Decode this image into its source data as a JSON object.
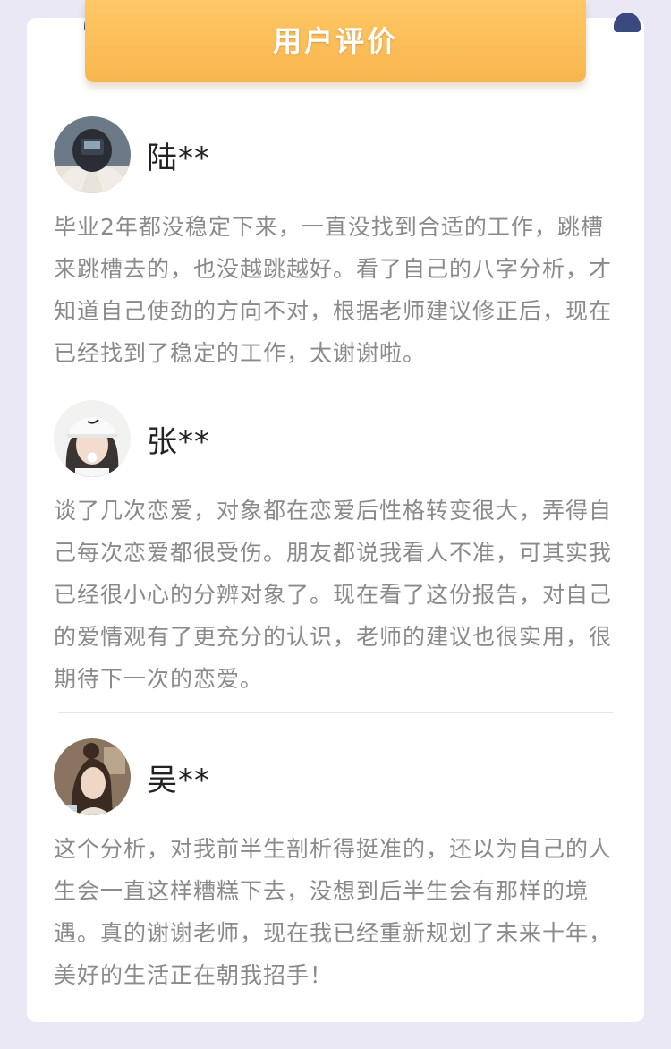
{
  "section": {
    "title": "用户评价"
  },
  "reviews": [
    {
      "name": "陆**",
      "text": "毕业2年都没稳定下来，一直没找到合适的工作，跳槽来跳槽去的，也没越跳越好。看了自己的八字分析，才知道自己使劲的方向不对，根据老师建议修正后，现在已经找到了稳定的工作，太谢谢啦。"
    },
    {
      "name": "张**",
      "text": "谈了几次恋爱，对象都在恋爱后性格转变很大，弄得自己每次恋爱都很受伤。朋友都说我看人不准，可其实我已经很小心的分辨对象了。现在看了这份报告，对自己的爱情观有了更充分的认识，老师的建议也很实用，很期待下一次的恋爱。"
    },
    {
      "name": "吴**",
      "text": "这个分析，对我前半生剖析得挺准的，还以为自己的人生会一直这样糟糕下去，没想到后半生会有那样的境遇。真的谢谢老师，现在我已经重新规划了未来十年，美好的生活正在朝我招手！"
    }
  ],
  "colors": {
    "background": "#e9e8f4",
    "banner": "#f8b54f",
    "knob": "#3b4a7e",
    "body_text": "#8a8a8a",
    "name_text": "#222222"
  }
}
